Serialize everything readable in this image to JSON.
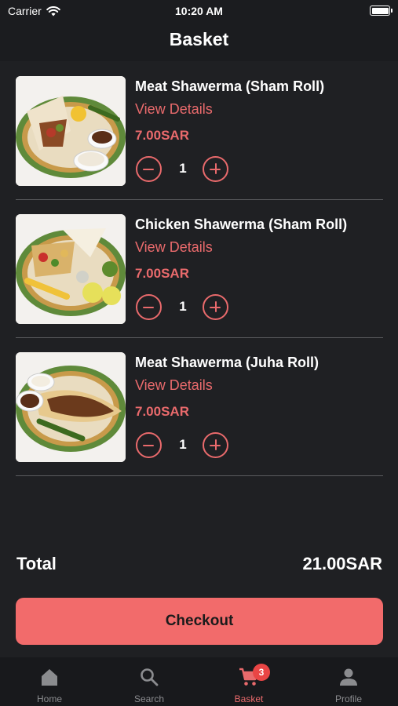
{
  "status_bar": {
    "carrier": "Carrier",
    "time": "10:20 AM"
  },
  "header": {
    "title": "Basket"
  },
  "items": [
    {
      "name": "Meat Shawerma (Sham Roll)",
      "details_label": "View Details",
      "price": "7.00SAR",
      "quantity": "1"
    },
    {
      "name": "Chicken Shawerma (Sham Roll)",
      "details_label": "View Details",
      "price": "7.00SAR",
      "quantity": "1"
    },
    {
      "name": "Meat Shawerma (Juha Roll)",
      "details_label": "View Details",
      "price": "7.00SAR",
      "quantity": "1"
    }
  ],
  "summary": {
    "total_label": "Total",
    "total_value": "21.00SAR"
  },
  "checkout_label": "Checkout",
  "tab_bar": {
    "tabs": [
      {
        "label": "Home",
        "icon": "home-icon",
        "active": false
      },
      {
        "label": "Search",
        "icon": "search-icon",
        "active": false
      },
      {
        "label": "Basket",
        "icon": "cart-icon",
        "active": true,
        "badge": "3"
      },
      {
        "label": "Profile",
        "icon": "person-icon",
        "active": false
      }
    ]
  },
  "colors": {
    "accent": "#e96a6c",
    "checkout_button": "#f26b6b",
    "background": "#1f2023",
    "badge": "#e94545"
  }
}
